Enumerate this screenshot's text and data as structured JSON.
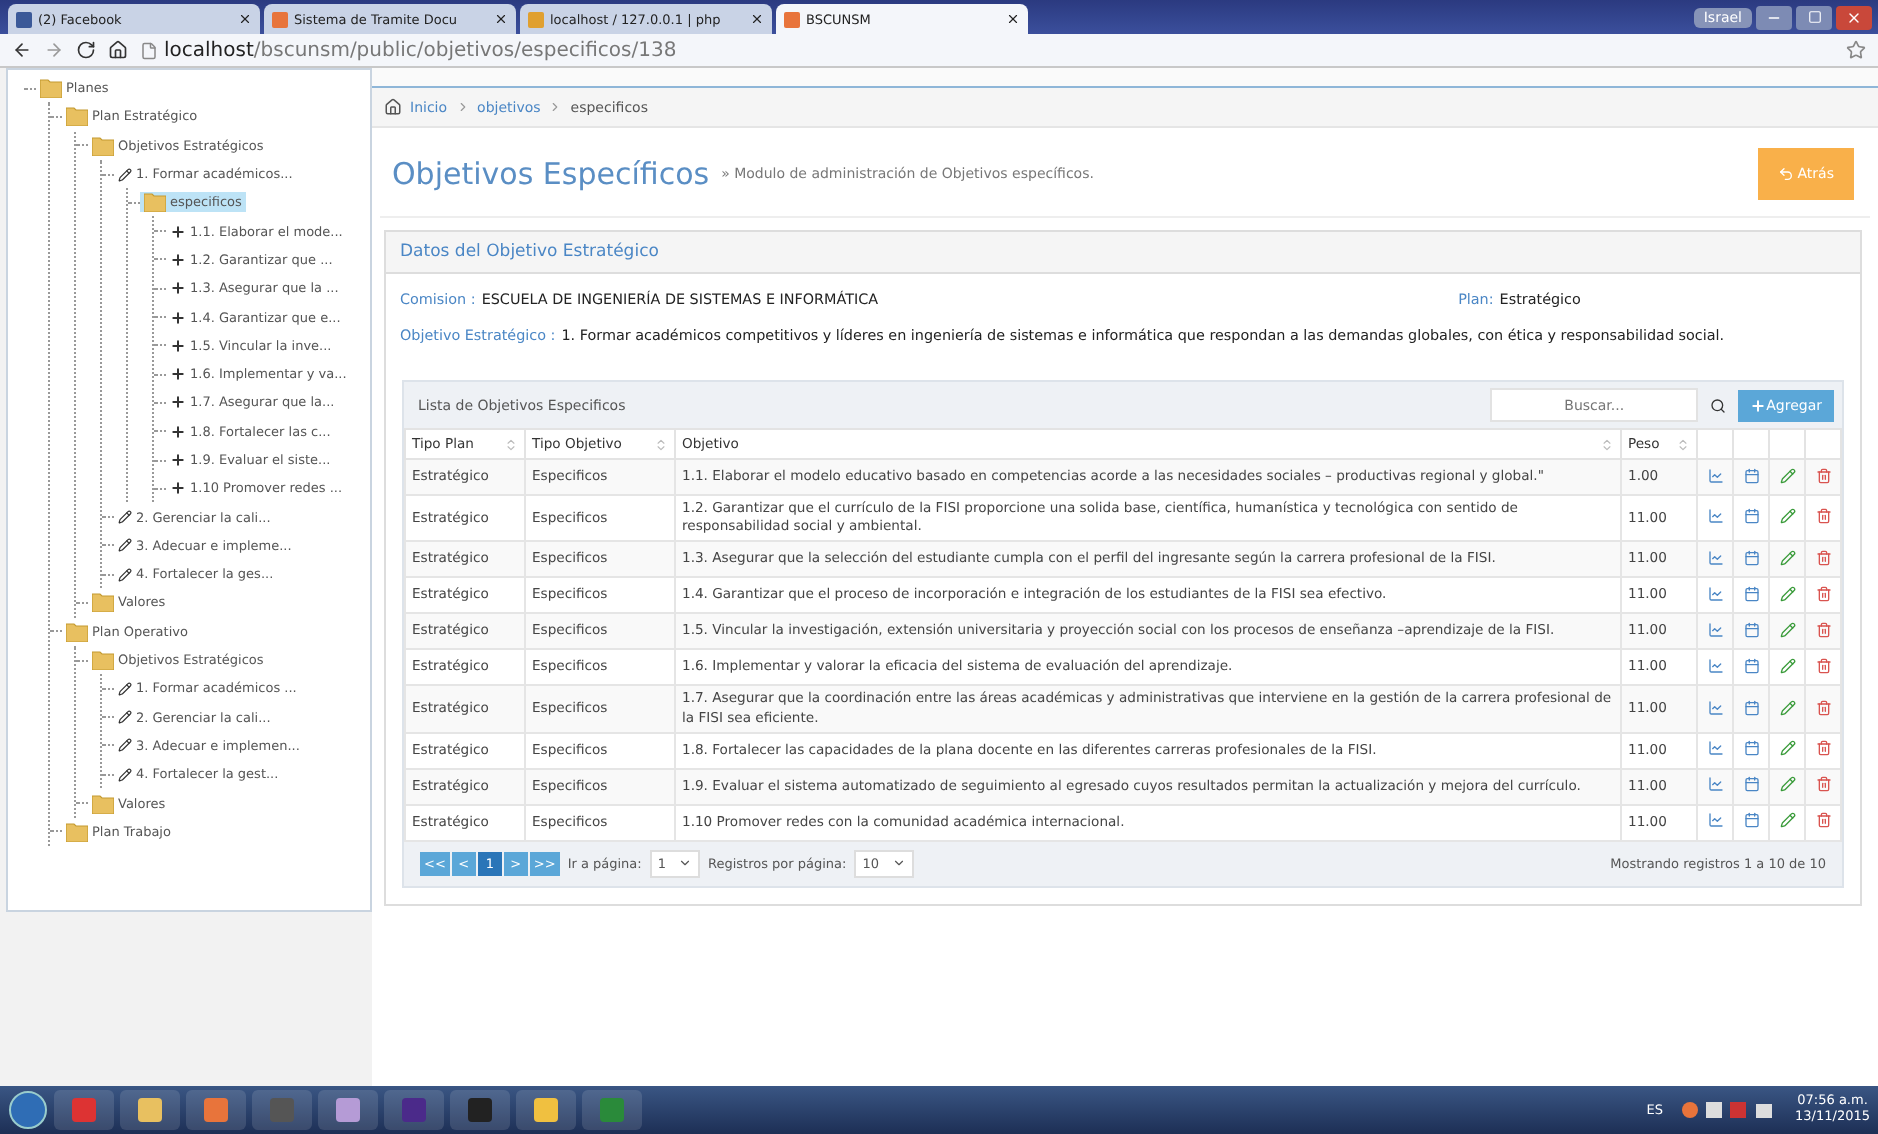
{
  "browser": {
    "tabs": [
      {
        "label": "(2) Facebook",
        "selected": false
      },
      {
        "label": "Sistema de Tramite Docu",
        "selected": false
      },
      {
        "label": "localhost / 127.0.0.1 | php",
        "selected": false
      },
      {
        "label": "BSCUNSM",
        "selected": true
      }
    ],
    "user": "Israel",
    "address_host": "localhost",
    "address_path": "/bscunsm/public/objetivos/especificos/138"
  },
  "tree": [
    {
      "label": "Planes",
      "kind": "folder",
      "selected": false,
      "children": [
        {
          "label": "Plan Estratégico",
          "kind": "folder",
          "selected": false,
          "children": [
            {
              "label": "Objetivos Estratégicos",
              "kind": "folder",
              "selected": false,
              "children": [
                {
                  "label": "1. Formar académicos...",
                  "kind": "objective",
                  "selected": false,
                  "children": [
                    {
                      "label": "especificos",
                      "kind": "folder",
                      "selected": true,
                      "children": [
                        {
                          "label": "1.1. Elaborar el mode...",
                          "kind": "item",
                          "selected": false
                        },
                        {
                          "label": "1.2. Garantizar que ...",
                          "kind": "item",
                          "selected": false
                        },
                        {
                          "label": "1.3. Asegurar que la ...",
                          "kind": "item",
                          "selected": false
                        },
                        {
                          "label": "1.4. Garantizar que e...",
                          "kind": "item",
                          "selected": false
                        },
                        {
                          "label": "1.5. Vincular la inve...",
                          "kind": "item",
                          "selected": false
                        },
                        {
                          "label": "1.6. Implementar y va...",
                          "kind": "item",
                          "selected": false
                        },
                        {
                          "label": "1.7. Asegurar que la...",
                          "kind": "item",
                          "selected": false
                        },
                        {
                          "label": "1.8. Fortalecer las c...",
                          "kind": "item",
                          "selected": false
                        },
                        {
                          "label": "1.9. Evaluar el siste...",
                          "kind": "item",
                          "selected": false
                        },
                        {
                          "label": "1.10 Promover redes ...",
                          "kind": "item",
                          "selected": false
                        }
                      ]
                    }
                  ]
                },
                {
                  "label": "2. Gerenciar la cali...",
                  "kind": "objective",
                  "selected": false
                },
                {
                  "label": "3. Adecuar e impleme...",
                  "kind": "objective",
                  "selected": false
                },
                {
                  "label": "4. Fortalecer la ges...",
                  "kind": "objective",
                  "selected": false
                }
              ]
            },
            {
              "label": "Valores",
              "kind": "folder",
              "selected": false
            }
          ]
        },
        {
          "label": "Plan Operativo",
          "kind": "folder",
          "selected": false,
          "children": [
            {
              "label": "Objetivos Estratégicos",
              "kind": "folder",
              "selected": false,
              "children": [
                {
                  "label": "1. Formar académicos ...",
                  "kind": "objective",
                  "selected": false
                },
                {
                  "label": "2. Gerenciar la cali...",
                  "kind": "objective",
                  "selected": false
                },
                {
                  "label": "3. Adecuar e implemen...",
                  "kind": "objective",
                  "selected": false
                },
                {
                  "label": "4. Fortalecer la gest...",
                  "kind": "objective",
                  "selected": false
                }
              ]
            },
            {
              "label": "Valores",
              "kind": "folder",
              "selected": false
            }
          ]
        },
        {
          "label": "Plan Trabajo",
          "kind": "folder",
          "selected": false
        }
      ]
    }
  ],
  "breadcrumb": [
    "Inicio",
    "objetivos",
    "especificos"
  ],
  "page": {
    "title": "Objetivos Específicos",
    "subtitle": "» Modulo de administración de Objetivos específicos.",
    "back_button": "Atrás"
  },
  "details": {
    "title": "Datos del Objetivo Estratégico",
    "commission_label": "Comision :",
    "commission": "ESCUELA DE INGENIERÍA DE SISTEMAS E INFORMÁTICA",
    "plan_label": "Plan:",
    "plan": "Estratégico",
    "objective_label": "Objetivo Estratégico :",
    "objective": "1. Formar académicos competitivos y líderes en ingeniería de sistemas e informática que respondan a las demandas globales, con ética y responsabilidad social."
  },
  "table": {
    "title": "Lista de Objetivos Especificos",
    "search": {
      "placeholder": "Buscar..."
    },
    "add_button": "Agregar",
    "columns": [
      "Tipo Plan",
      "Tipo Objetivo",
      "Objetivo",
      "Peso"
    ],
    "rows": [
      [
        "Estratégico",
        "Especificos",
        "1.1. Elaborar el modelo educativo basado en competencias acorde a las necesidades sociales – productivas regional y global.\"",
        "1.00"
      ],
      [
        "Estratégico",
        "Especificos",
        "1.2. Garantizar que el currículo de la FISI proporcione una solida base, científica, humanística y tecnológica con sentido de responsabilidad social y ambiental.",
        "11.00"
      ],
      [
        "Estratégico",
        "Especificos",
        "1.3. Asegurar que la selección del estudiante cumpla con el perfil del ingresante según la carrera profesional de la FISI.",
        "11.00"
      ],
      [
        "Estratégico",
        "Especificos",
        "1.4. Garantizar que el proceso de incorporación e integración de los estudiantes de la FISI sea efectivo.",
        "11.00"
      ],
      [
        "Estratégico",
        "Especificos",
        "1.5. Vincular la investigación, extensión universitaria y proyección social con los procesos de enseñanza –aprendizaje de la FISI.",
        "11.00"
      ],
      [
        "Estratégico",
        "Especificos",
        "1.6. Implementar y valorar la eficacia del sistema de evaluación del aprendizaje.",
        "11.00"
      ],
      [
        "Estratégico",
        "Especificos",
        "1.7. Asegurar que la coordinación entre las áreas académicas y administrativas que interviene en la gestión de la carrera profesional de la FISI sea eficiente.",
        "11.00"
      ],
      [
        "Estratégico",
        "Especificos",
        "1.8. Fortalecer las capacidades de la plana docente en las diferentes carreras profesionales de la FISI.",
        "11.00"
      ],
      [
        "Estratégico",
        "Especificos",
        "1.9. Evaluar el sistema automatizado de seguimiento al egresado cuyos resultados permitan la actualización y mejora del currículo.",
        "11.00"
      ],
      [
        "Estratégico",
        "Especificos",
        "1.10 Promover redes con la comunidad académica internacional.",
        "11.00"
      ]
    ],
    "pager": [
      {
        "label": "<<",
        "selected": false
      },
      {
        "label": "<",
        "selected": false
      },
      {
        "label": "1",
        "selected": true
      },
      {
        "label": ">",
        "selected": false
      },
      {
        "label": ">>",
        "selected": false
      }
    ],
    "goto_label": "Ir a página:",
    "goto_value": "1",
    "per_page_label": "Registros por página:",
    "per_page_value": "10",
    "summary": "Mostrando registros 1 a 10 de 10"
  },
  "taskbar": {
    "language": "ES",
    "time": "07:56 a.m.",
    "date": "13/11/2015"
  }
}
